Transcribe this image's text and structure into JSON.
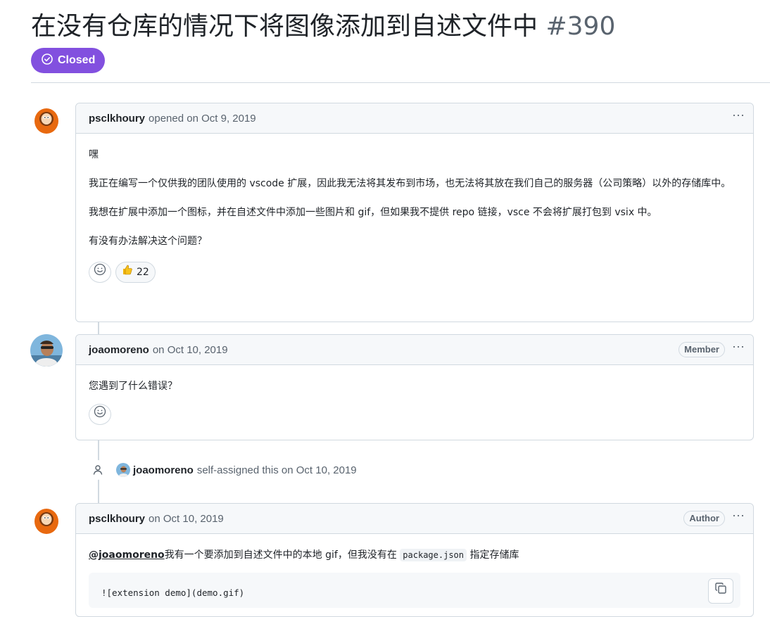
{
  "issue": {
    "title": "在没有仓库的情况下将图像添加到自述文件中",
    "number": "#390",
    "state": "Closed",
    "state_color": "#8250df"
  },
  "comments": [
    {
      "author": "psclkhoury",
      "meta": "opened on Oct 9, 2019",
      "paragraphs": [
        "嘿",
        "我正在编写一个仅供我的团队使用的 vscode 扩展，因此我无法将其发布到市场，也无法将其放在我们自己的服务器（公司策略）以外的存储库中。",
        "我想在扩展中添加一个图标，并在自述文件中添加一些图片和 gif，但如果我不提供 repo 链接，vsce 不会将扩展打包到 vsix 中。",
        "有没有办法解决这个问题？"
      ],
      "reactions": [
        {
          "icon": "thumbs-up-icon",
          "count": "22"
        }
      ]
    },
    {
      "author": "joaomoreno",
      "meta": "on Oct 10, 2019",
      "role": "Member",
      "paragraphs": [
        "您遇到了什么错误？"
      ]
    },
    {
      "author": "psclkhoury",
      "meta": "on Oct 10, 2019",
      "role": "Author",
      "mention": "@joaomoreno",
      "text_before_code": "我有一个要添加到自述文件中的本地 gif，但我没有在",
      "inline_code": "package.json",
      "text_after_code": "指定存储库",
      "code_block": "![extension demo](demo.gif)"
    }
  ],
  "event": {
    "actor": "joaomoreno",
    "text": "self-assigned this on Oct 10, 2019"
  },
  "kebab": "···"
}
